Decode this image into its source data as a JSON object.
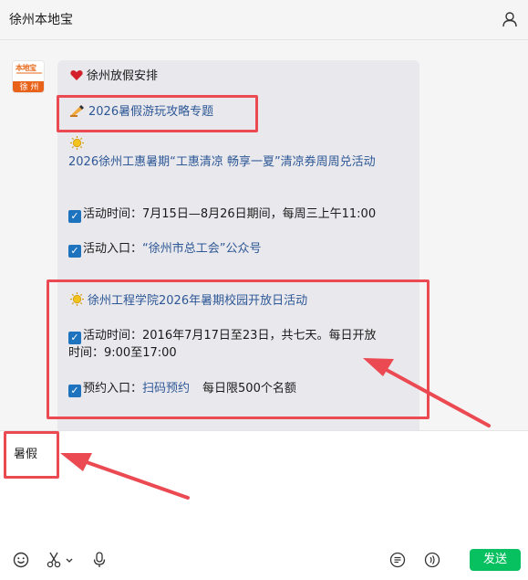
{
  "header": {
    "title": "徐州本地宝",
    "user_icon": "user-icon"
  },
  "avatar": {
    "top_text": "本地宝",
    "bottom_text": "徐 州"
  },
  "message": {
    "line1": "徐州放假安排",
    "line2": "2026暑假游玩攻略专题",
    "line3": "2026徐州工惠暑期“工惠清凉 畅享一夏”清凉券周周兑活动",
    "line4": "活动时间：7月15日—8月26日期间，每周三上午11:00",
    "line5_prefix": "活动入口：",
    "line5_link": "“徐州市总工会”公众号",
    "line6": "徐州工程学院2026年暑期校园开放日活动",
    "line7a": "活动时间：2016年7月17日至23日，共七天。每日开放",
    "line7b": "时间：9:00至17:00",
    "line8_prefix": "预约入口：",
    "line8_link": "扫码预约",
    "line8_suffix": "每日限500个名额"
  },
  "input": {
    "value": "暑假"
  },
  "toolbar": {
    "icons": [
      "emoji-icon",
      "scissors-icon",
      "chevron-down-icon",
      "microphone-icon",
      "chat-history-icon",
      "voice-call-icon"
    ],
    "send_label": "发送"
  },
  "colors": {
    "annotation": "#ec4a52",
    "link": "#2d5796",
    "send": "#07c160",
    "check": "#1e73be"
  }
}
